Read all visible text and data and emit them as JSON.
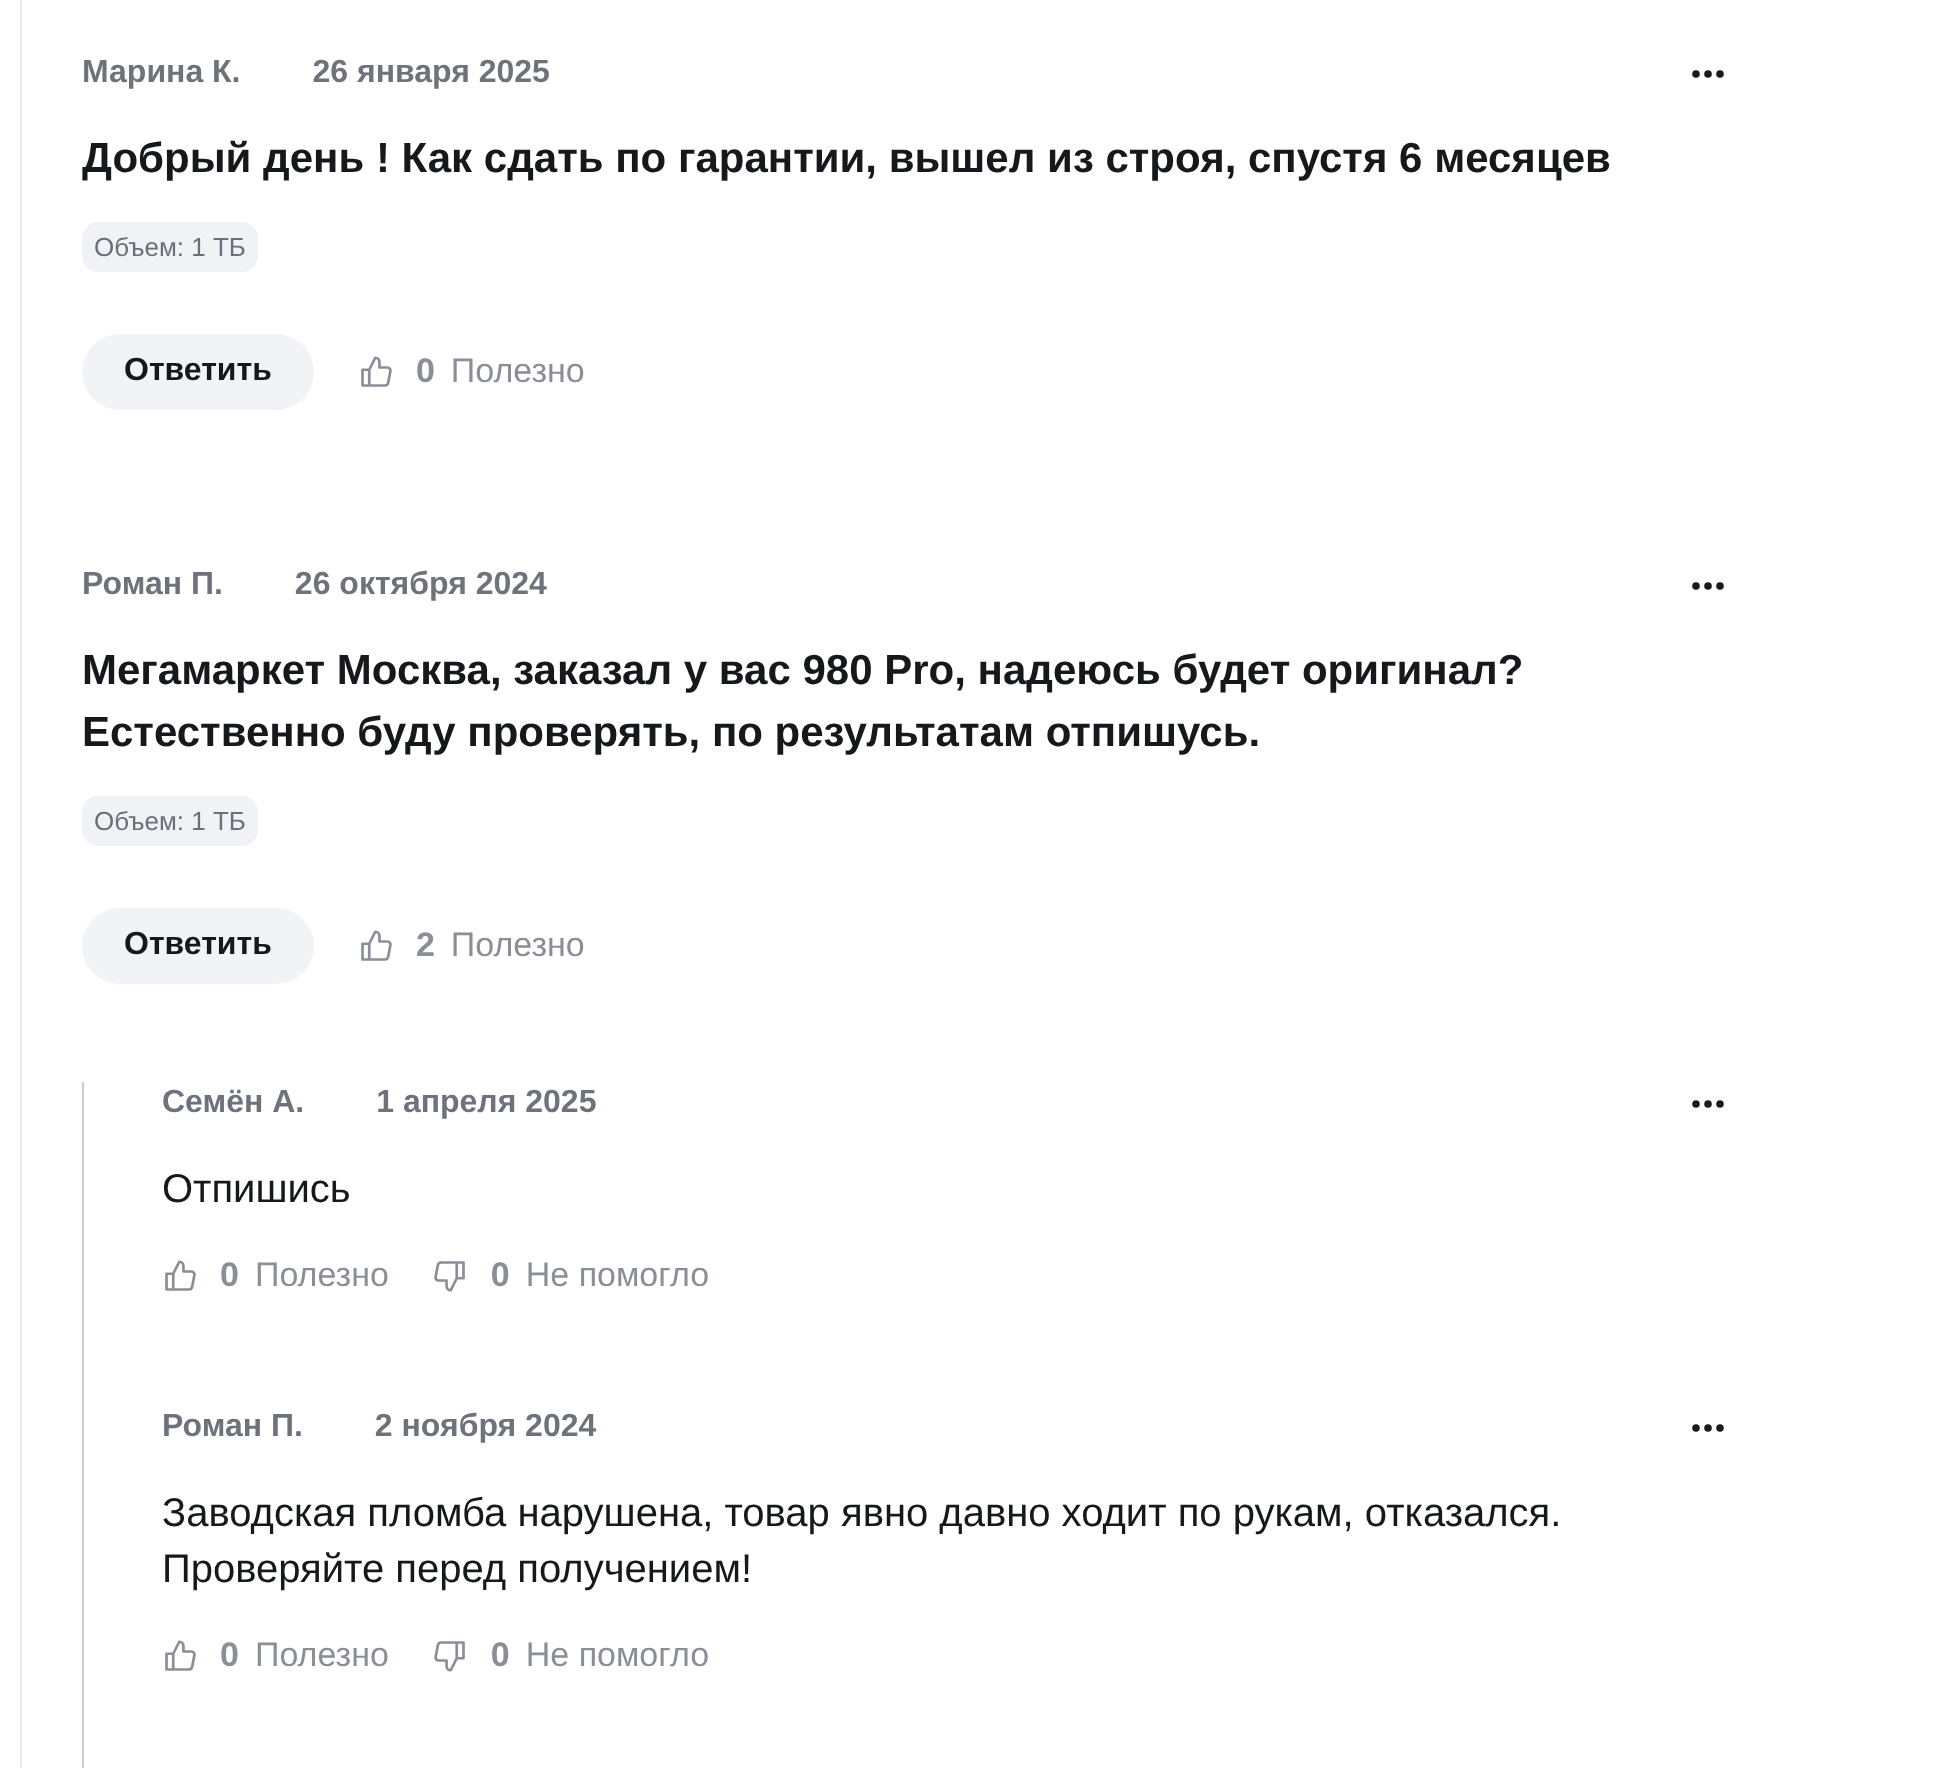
{
  "comments": [
    {
      "author": "Марина К.",
      "date": "26 января 2025",
      "text": "Добрый день ! Как сдать по гарантии, вышел из строя, спустя 6 месяцев",
      "tags": [
        "Объем: 1 ТБ"
      ],
      "reply_label": "Ответить",
      "helpful": {
        "count": "0",
        "label": "Полезно"
      }
    },
    {
      "author": "Роман П.",
      "date": "26 октября 2024",
      "text": "Мегамаркет Москва, заказал у вас 980 Pro, надеюсь будет оригинал? Естественно буду проверять, по результатам отпишусь.",
      "tags": [
        "Объем: 1 ТБ"
      ],
      "reply_label": "Ответить",
      "helpful": {
        "count": "2",
        "label": "Полезно"
      },
      "replies": [
        {
          "author": "Семён А.",
          "date": "1 апреля 2025",
          "text": "Отпишись",
          "helpful": {
            "count": "0",
            "label": "Полезно"
          },
          "not_helpful": {
            "count": "0",
            "label": "Не помогло"
          }
        },
        {
          "author": "Роман П.",
          "date": "2 ноября 2024",
          "text": "Заводская пломба нарушена, товар явно давно ходит по рукам, отказался. Проверяйте перед получением!",
          "helpful": {
            "count": "0",
            "label": "Полезно"
          },
          "not_helpful": {
            "count": "0",
            "label": "Не помогло"
          }
        }
      ]
    }
  ]
}
